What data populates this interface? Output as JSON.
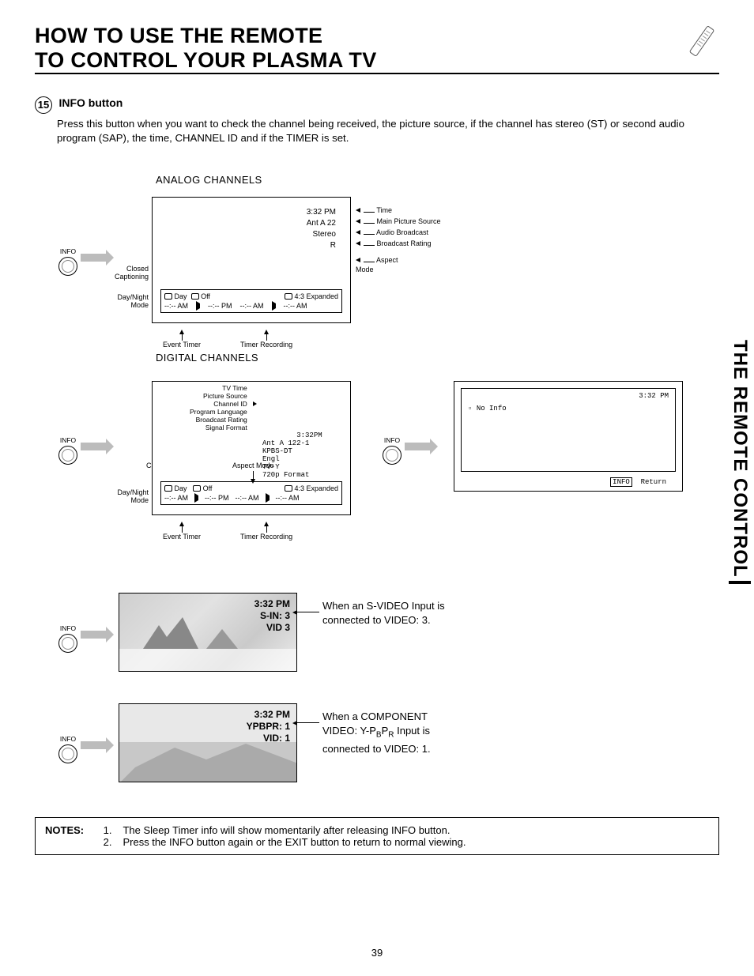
{
  "title_line1": "HOW TO USE THE REMOTE",
  "title_line2": "TO CONTROL YOUR PLASMA TV",
  "sidebar_title": "THE REMOTE CONTROL",
  "section_number": "15",
  "section_head": "INFO button",
  "section_body": "Press this button when you want to check the channel being received, the picture source, if the channel has stereo (ST) or second audio program (SAP), the time, CHANNEL ID and if the TIMER is set.",
  "analog_title": "ANALOG CHANNELS",
  "digital_title": "DIGITAL CHANNELS",
  "info_label": "INFO",
  "analog": {
    "time": "3:32 PM",
    "source": "Ant  A  22",
    "audio": "Stereo",
    "rating": "R",
    "labels": {
      "time": "Time",
      "source": "Main Picture Source",
      "audio": "Audio Broadcast",
      "rating": "Broadcast Rating",
      "aspect": "Aspect\nMode",
      "cc": "Closed\nCaptioning",
      "dn": "Day/Night\nMode",
      "et": "Event Timer",
      "tr": "Timer Recording"
    },
    "strip": {
      "day": "Day",
      "cc_state": "Off",
      "aspect": "4:3 Expanded",
      "t1": "--:-- AM",
      "t2": "--:-- PM",
      "t3": "--:-- AM",
      "t4": "--:-- AM"
    }
  },
  "digital": {
    "label_block": "TV Time\nPicture Source\nChannel ID\nProgram Language\nBroadcast Rating\nSignal Format",
    "values_block": "3:32PM\nAnt A 122-1\nKPBS-DT\nEngl\nTV-Y\n720p Format",
    "cc_label": "Closed\nCaptioning",
    "aspect_label": "Aspect Mode",
    "dn_label": "Day/Night\nMode",
    "et_label": "Event Timer",
    "tr_label": "Timer Recording",
    "strip": {
      "day": "Day",
      "cc_state": "Off",
      "aspect": "4:3 Expanded",
      "t1": "--:-- AM",
      "t2": "--:-- PM",
      "t3": "--:-- AM",
      "t4": "--:-- AM"
    },
    "noinfo": "No Info",
    "noinfo_time": "3:32 PM",
    "return": "Return",
    "info_badge": "INFO"
  },
  "video1": {
    "time": "3:32 PM",
    "sin": "S-IN: 3",
    "vid": "VID 3",
    "desc": "When an S-VIDEO Input is connected to VIDEO: 3."
  },
  "video2": {
    "time": "3:32 PM",
    "ypbpr": "YPBPR: 1",
    "vid": "VID: 1",
    "desc_pre": "When a COMPONENT VIDEO: Y-P",
    "desc_b": "B",
    "desc_p": "P",
    "desc_r": "R",
    "desc_post": " Input is connected to VIDEO: 1."
  },
  "notes_label": "NOTES:",
  "notes": [
    "The Sleep Timer info will show momentarily after releasing INFO button.",
    "Press the INFO button again or the EXIT button to return to normal viewing."
  ],
  "page_number": "39"
}
